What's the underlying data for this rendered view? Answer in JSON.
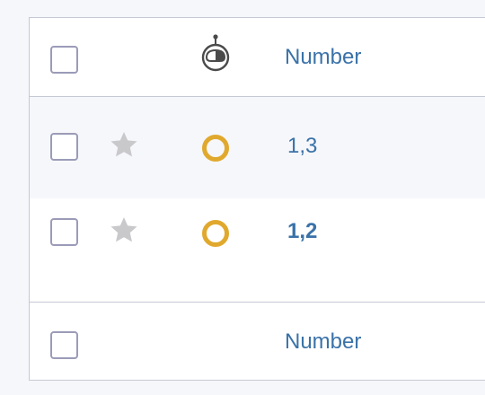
{
  "table": {
    "header": {
      "robot_icon": "robot-icon",
      "column_label": "Number"
    },
    "rows": [
      {
        "value": "1,3",
        "starred": false,
        "status_icon": "ring-icon",
        "unread": false
      },
      {
        "value": "1,2",
        "starred": false,
        "status_icon": "ring-icon",
        "unread": true
      }
    ],
    "footer": {
      "column_label": "Number"
    }
  },
  "colors": {
    "accent_link": "#3a72a8",
    "status_ring": "#e0a92e",
    "star_inactive": "#c9c9cc",
    "row_alt_bg": "#f6f7fb",
    "border": "#c6c8d4"
  }
}
